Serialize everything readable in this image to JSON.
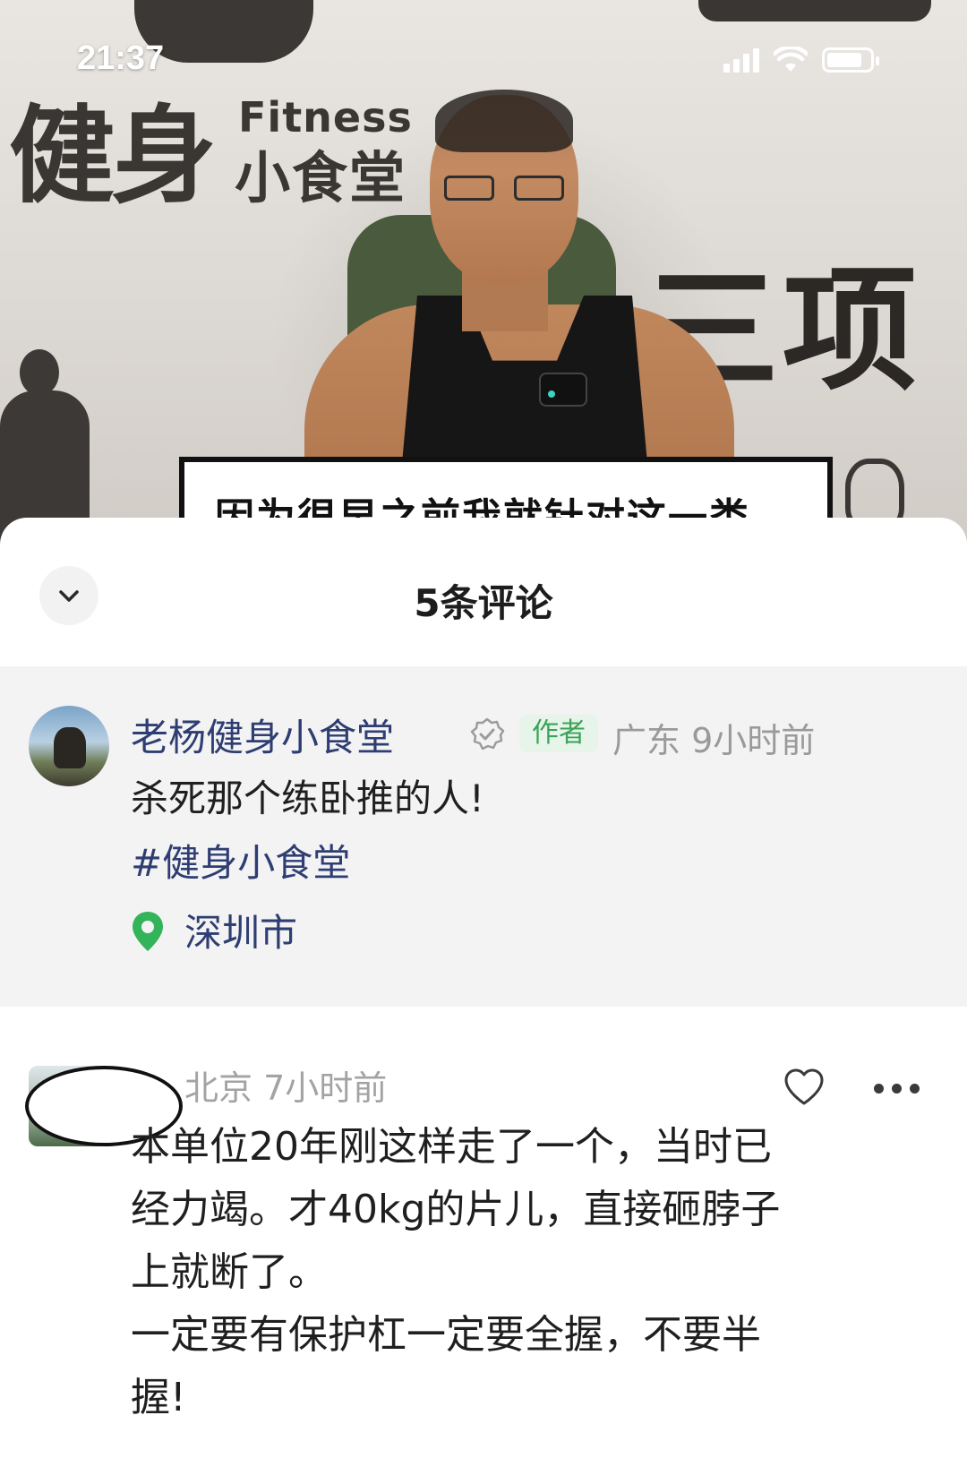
{
  "status_bar": {
    "time": "21:37"
  },
  "video": {
    "wall_brand_big": "健身",
    "wall_brand_en": "Fitness",
    "wall_brand_small": "小食堂",
    "wall_text": "三项之",
    "subtitle": "因为很早之前我就针对这一类"
  },
  "sheet": {
    "title": "5条评论",
    "collapse_icon": "chevron-down-icon"
  },
  "author_post": {
    "name": "老杨健身小食堂",
    "badge_icon": "verified-icon",
    "tag": "作者",
    "region": "广东",
    "time": "9小时前",
    "text": "杀死那个练卧推的人!",
    "hashtag": "#健身小食堂",
    "location": "深圳市",
    "colors": {
      "link": "#2e3d72",
      "tag_bg": "#e7f4ea",
      "tag_text": "#3aa357",
      "location_pin": "#33b35a"
    }
  },
  "comment": {
    "region": "北京",
    "time": "7小时前",
    "like_icon": "heart-icon",
    "more_icon": "more-icon",
    "lines": [
      "本单位20年刚这样走了一个，当时已",
      "经力竭。才40kg的片儿，直接砸脖子",
      "上就断了。",
      "一定要有保护杠一定要全握，不要半",
      "握!"
    ]
  }
}
